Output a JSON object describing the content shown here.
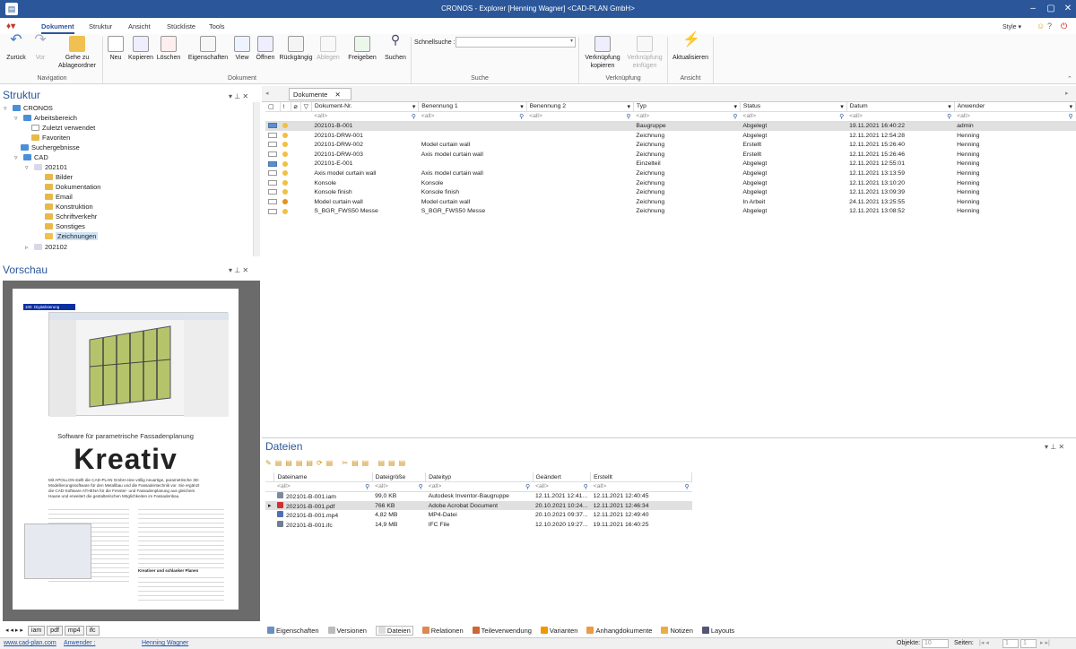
{
  "titlebar": {
    "title": "CRONOS - Explorer [Henning Wagner] <CAD-PLAN GmbH>",
    "style_label": "Style"
  },
  "ribbon_tabs": [
    "Dokument",
    "Struktur",
    "Ansicht",
    "Stückliste",
    "Tools"
  ],
  "ribbon": {
    "buttons": [
      {
        "label": "Zurück",
        "group": "Navigation"
      },
      {
        "label": "Vor",
        "group": "Navigation",
        "disabled": true
      },
      {
        "label": "Gehe zu Ablageordner",
        "group": "Navigation"
      },
      {
        "label": "Neu",
        "group": "Dokument"
      },
      {
        "label": "Kopieren",
        "group": "Dokument"
      },
      {
        "label": "Löschen",
        "group": "Dokument"
      },
      {
        "label": "Eigenschaften",
        "group": "Dokument"
      },
      {
        "label": "View",
        "group": "Dokument"
      },
      {
        "label": "Öffnen",
        "group": "Dokument"
      },
      {
        "label": "Rückgängig",
        "group": "Dokument"
      },
      {
        "label": "Ablegen",
        "group": "Dokument",
        "disabled": true
      },
      {
        "label": "Freigeben",
        "group": "Dokument"
      },
      {
        "label": "Suchen",
        "group": "Dokument"
      },
      {
        "label": "Verknüpfung kopieren",
        "group": "Verknüpfung"
      },
      {
        "label": "Verknüpfung einfügen",
        "group": "Verknüpfung",
        "disabled": true
      },
      {
        "label": "Aktualisieren",
        "group": "Ansicht"
      }
    ],
    "groups": [
      "Navigation",
      "Dokument",
      "Suche",
      "Verknüpfung",
      "Ansicht"
    ],
    "quicksearch_label": "Schnellsuche :"
  },
  "struktur": {
    "title": "Struktur",
    "tree": [
      {
        "label": "CRONOS",
        "level": 0
      },
      {
        "label": "Arbeitsbereich",
        "level": 1
      },
      {
        "label": "Zuletzt verwendet",
        "level": 2
      },
      {
        "label": "Favoriten",
        "level": 2
      },
      {
        "label": "Suchergebnisse",
        "level": 1
      },
      {
        "label": "CAD",
        "level": 1
      },
      {
        "label": "202101",
        "level": 2
      },
      {
        "label": "Bilder",
        "level": 3
      },
      {
        "label": "Dokumentation",
        "level": 3
      },
      {
        "label": "Email",
        "level": 3
      },
      {
        "label": "Konstruktion",
        "level": 3
      },
      {
        "label": "Schriftverkehr",
        "level": 3
      },
      {
        "label": "Sonstiges",
        "level": 3
      },
      {
        "label": "Zeichnungen",
        "level": 3,
        "selected": true
      },
      {
        "label": "202102",
        "level": 2
      }
    ]
  },
  "vorschau": {
    "title": "Vorschau",
    "page_heading": "Software für parametrische Fassadenplanung",
    "page_big": "Kreativ",
    "page_tag": "Digitalisierung",
    "page_tag_left": "100",
    "page_intro": "Mit APOLLON stellt die CAD-PLAN GmbH eine völlig neuartige, parametrische 3D-Modellierungssoftware für den Metallbau und die Fassadentechnik vor. Sie ergänzt die CAD-Software ATHENA für die Fenster- und Fassadenplanung aus gleichem Hause und erweitert die gestalterischen Möglichkeiten im Fassadenbau.",
    "page_sub": "Kreativer und schlanker Planen",
    "preview_tabs": [
      "iam",
      "pdf",
      "mp4",
      "ifc"
    ]
  },
  "documents_tab": "Dokumente",
  "documents": {
    "columns": [
      "Dokument-Nr.",
      "Benennung 1",
      "Benennung 2",
      "Typ",
      "Status",
      "Datum",
      "Anwender"
    ],
    "filter": "<all>",
    "rows": [
      [
        "202101-B-001",
        "",
        "",
        "Baugruppe",
        "Abgelegt",
        "19.11.2021 16:40:22",
        "admin"
      ],
      [
        "202101-DRW-001",
        "",
        "",
        "Zeichnung",
        "Abgelegt",
        "12.11.2021 12:54:28",
        "Henning"
      ],
      [
        "202101-DRW-002",
        "Model curtain wall",
        "",
        "Zeichnung",
        "Erstellt",
        "12.11.2021 15:26:40",
        "Henning"
      ],
      [
        "202101-DRW-003",
        "Axis model curtain wall",
        "",
        "Zeichnung",
        "Erstellt",
        "12.11.2021 15:26:46",
        "Henning"
      ],
      [
        "202101-E-001",
        "",
        "",
        "Einzelteil",
        "Abgelegt",
        "12.11.2021 12:55:01",
        "Henning"
      ],
      [
        "Axis model curtain wall",
        "Axis model curtain wall",
        "",
        "Zeichnung",
        "Abgelegt",
        "12.11.2021 13:13:59",
        "Henning"
      ],
      [
        "Konsole",
        "Konsole",
        "",
        "Zeichnung",
        "Abgelegt",
        "12.11.2021 13:10:20",
        "Henning"
      ],
      [
        "Konsole finish",
        "Konsole finish",
        "",
        "Zeichnung",
        "Abgelegt",
        "12.11.2021 13:09:39",
        "Henning"
      ],
      [
        "Model curtain wall",
        "Model curtain wall",
        "",
        "Zeichnung",
        "In Arbeit",
        "24.11.2021 13:25:55",
        "Henning"
      ],
      [
        "S_BGR_FWS50 Messe",
        "S_BGR_FWS50 Messe",
        "",
        "Zeichnung",
        "Abgelegt",
        "12.11.2021 13:08:52",
        "Henning"
      ]
    ]
  },
  "dateien": {
    "title": "Dateien",
    "columns": [
      "Dateiname",
      "Dateigröße",
      "Dateityp",
      "Geändert",
      "Erstellt"
    ],
    "filter": "<all>",
    "rows": [
      [
        "202101-B-001.iam",
        "99,0 KB",
        "Autodesk Inventor-Baugruppe",
        "12.11.2021 12:41...",
        "12.11.2021 12:40:45"
      ],
      [
        "202101-B-001.pdf",
        "766 KB",
        "Adobe Acrobat Document",
        "20.10.2021 10:24...",
        "12.11.2021 12:46:34"
      ],
      [
        "202101-B-001.mp4",
        "4,82 MB",
        "MP4-Datei",
        "20.10.2021 09:37...",
        "12.11.2021 12:49:40"
      ],
      [
        "202101-B-001.ifc",
        "14,9 MB",
        "IFC File",
        "12.10.2020 19:27...",
        "19.11.2021 16:40:25"
      ]
    ]
  },
  "bottom_tabs": [
    "Eigenschaften",
    "Versionen",
    "Dateien",
    "Relationen",
    "Teileverwendung",
    "Varianten",
    "Anhangdokumente",
    "Notizen",
    "Layouts"
  ],
  "statusbar": {
    "link": "www.cad-plan.com",
    "user_label": "Anwender :",
    "user": "Henning Wagner",
    "objects_label": "Objekte:",
    "objects": "10",
    "pages_label": "Seiten:",
    "page": "1",
    "pages": "1"
  }
}
